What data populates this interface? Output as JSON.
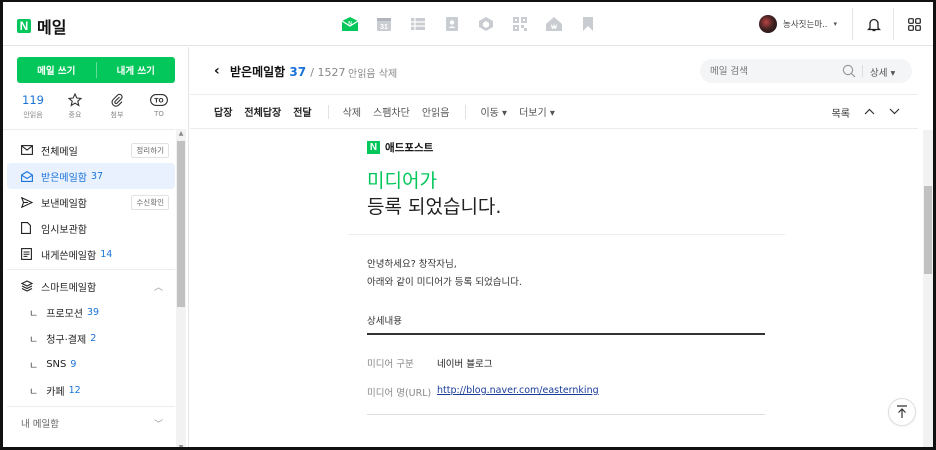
{
  "app": {
    "logo_letter": "N",
    "title": "메일",
    "brand_color": "#03c75a",
    "accent_color": "#1a73d9"
  },
  "topbar": {
    "apps": [
      "mail-icon",
      "calendar-icon",
      "contacts-list-icon",
      "address-book-icon",
      "mybox-icon",
      "qr-icon",
      "home-icon",
      "bookmark-icon"
    ],
    "calendar_day": "31",
    "profile_name": "농사짓는마..",
    "profile_caret": "▾"
  },
  "sidebar": {
    "compose_label": "메일 쓰기",
    "compose_self_label": "내게 쓰기",
    "quick": [
      {
        "num": "119",
        "label": "안읽음",
        "icon": ""
      },
      {
        "num": "",
        "label": "중요",
        "icon": "star-icon"
      },
      {
        "num": "",
        "label": "첨부",
        "icon": "paperclip-icon"
      },
      {
        "num": "",
        "label": "TO",
        "icon": "to-icon"
      }
    ],
    "to_badge": "TO",
    "folders": [
      {
        "label": "전체메일",
        "count": "",
        "tag": "정리하기",
        "icon": "envelope-icon"
      },
      {
        "label": "받은메일함",
        "count": "37",
        "tag": "",
        "icon": "inbox-icon",
        "active": true
      },
      {
        "label": "보낸메일함",
        "count": "",
        "tag": "수신확인",
        "icon": "send-icon"
      },
      {
        "label": "임시보관함",
        "count": "",
        "tag": "",
        "icon": "draft-icon"
      },
      {
        "label": "내게쓴메일함",
        "count": "14",
        "tag": "",
        "icon": "note-icon"
      }
    ],
    "smart": {
      "label": "스마트메일함",
      "chevron": "︿"
    },
    "smart_folders": [
      {
        "label": "프로모션",
        "count": "39"
      },
      {
        "label": "청구·결제",
        "count": "2"
      },
      {
        "label": "SNS",
        "count": "9"
      },
      {
        "label": "카페",
        "count": "12"
      }
    ],
    "sub_bullet": "ㄴ",
    "my_folders": {
      "label": "내 메일함",
      "chevron": "﹀"
    }
  },
  "header": {
    "back": "‹",
    "title": "받은메일함",
    "unread": "37",
    "total": "/ 1527",
    "delete_unread": "안읽음 삭제",
    "search_placeholder": "메일 검색",
    "search_detail": "상세 ▾"
  },
  "toolbar": {
    "reply": "답장",
    "reply_all": "전체답장",
    "forward": "전달",
    "delete": "삭제",
    "spam": "스팸차단",
    "unread": "안읽음",
    "move": "이동 ▾",
    "more": "더보기 ▾",
    "list": "목록"
  },
  "email": {
    "brand_letter": "N",
    "brand_name": "애드포스트",
    "headline_green": "미디어가",
    "headline_black": "등록 되었습니다.",
    "greeting1": "안녕하세요? 창작자님,",
    "greeting2": "아래와 같이 미디어가 등록 되었습니다.",
    "detail_title": "상세내용",
    "rows": [
      {
        "label": "미디어 구분",
        "value": "네이버 블로그"
      },
      {
        "label": "미디어 명(URL)",
        "value": "http://blog.naver.com/easternking"
      }
    ]
  }
}
